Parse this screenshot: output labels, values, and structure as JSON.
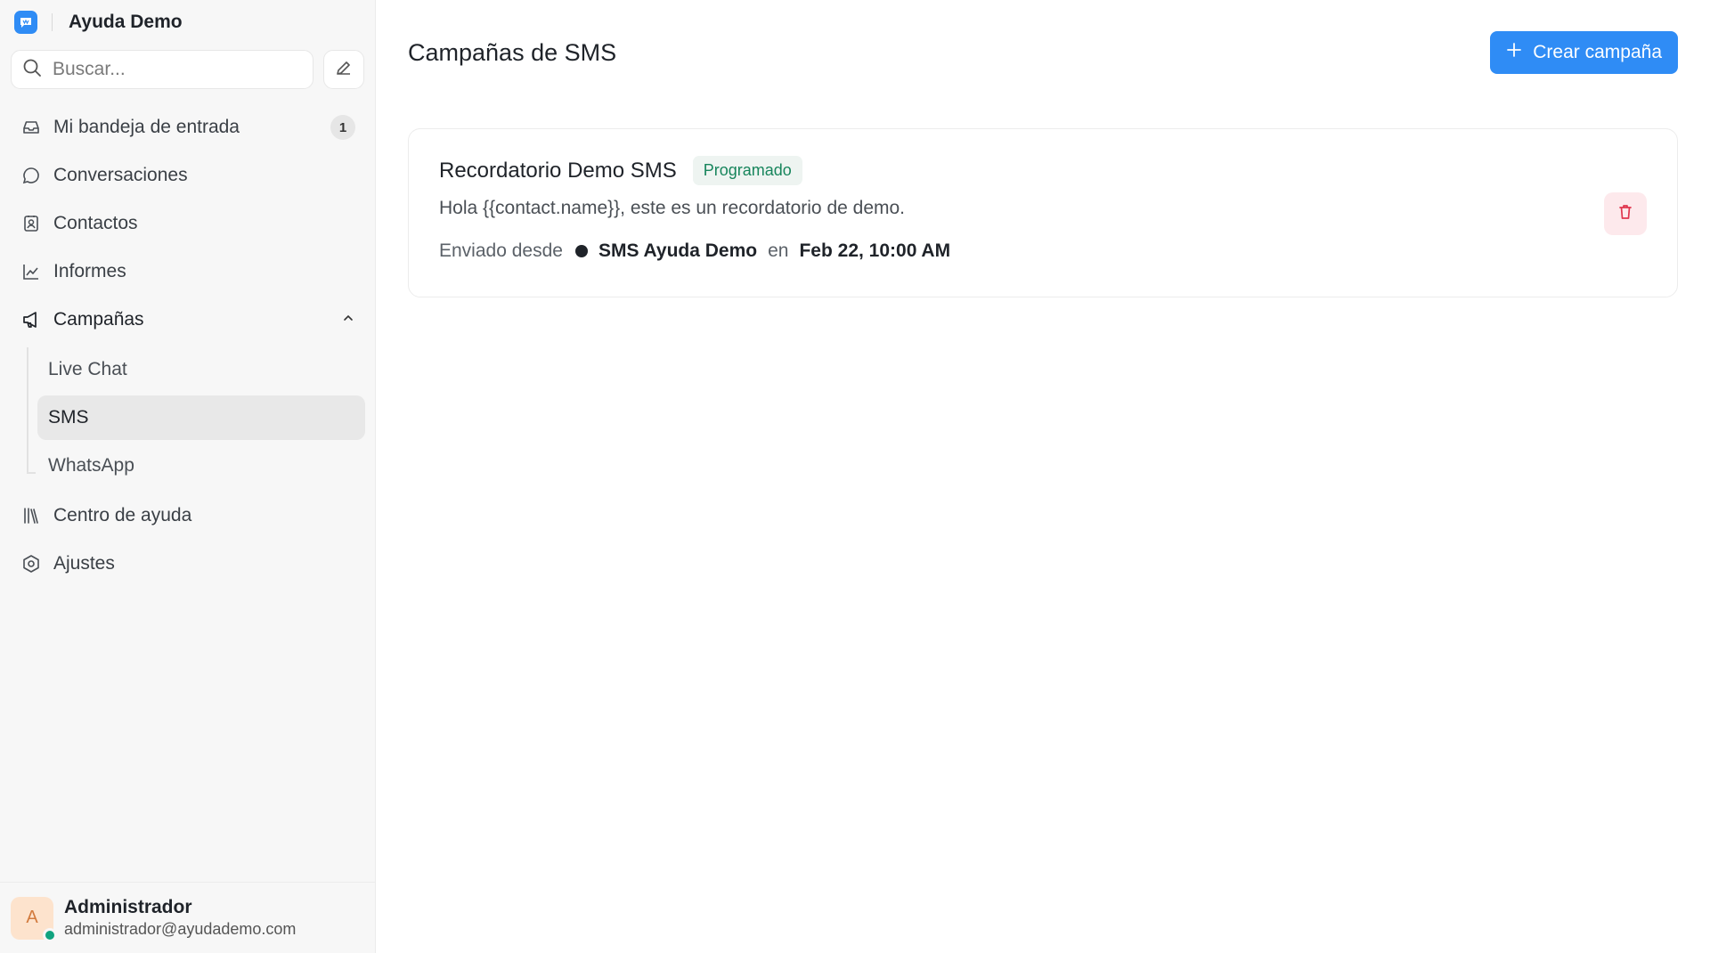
{
  "brand": {
    "name": "Ayuda Demo",
    "logo_icon": "chat-bubble-icon",
    "accent": "#2f8cf5"
  },
  "search": {
    "placeholder": "Buscar..."
  },
  "nav": {
    "inbox": {
      "label": "Mi bandeja de entrada",
      "count": "1"
    },
    "conversations": {
      "label": "Conversaciones"
    },
    "contacts": {
      "label": "Contactos"
    },
    "reports": {
      "label": "Informes"
    },
    "campaigns": {
      "label": "Campañas",
      "children": [
        {
          "label": "Live Chat"
        },
        {
          "label": "SMS",
          "active": true
        },
        {
          "label": "WhatsApp"
        }
      ]
    },
    "help_center": {
      "label": "Centro de ayuda"
    },
    "settings": {
      "label": "Ajustes"
    }
  },
  "user": {
    "initial": "A",
    "name": "Administrador",
    "email": "administrador@ayudademo.com",
    "status_color": "#10a37f"
  },
  "page": {
    "title": "Campañas de SMS",
    "create_label": "Crear campaña"
  },
  "campaign": {
    "title": "Recordatorio Demo SMS",
    "status": "Programado",
    "message": "Hola {{contact.name}}, este es un recordatorio de demo.",
    "sent_from_label": "Enviado desde",
    "inbox_name": "SMS Ayuda Demo",
    "on_label": "en",
    "scheduled_at": "Feb 22, 10:00 AM"
  }
}
